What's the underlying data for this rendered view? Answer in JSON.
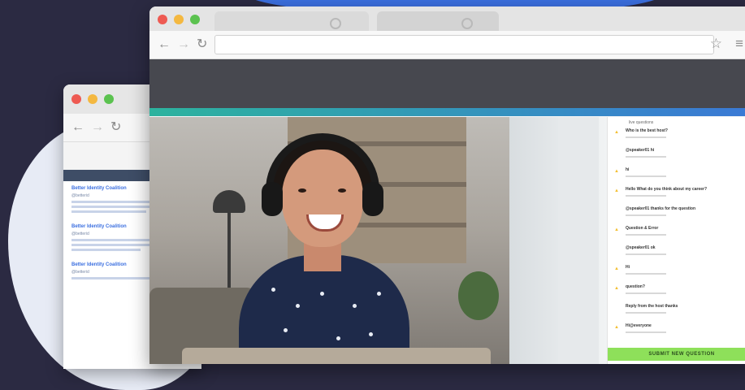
{
  "colors": {
    "background": "#2b2a42",
    "dot_red": "#ee5a52",
    "dot_yellow": "#f4b840",
    "dot_green": "#5bc24f",
    "accent_teal": "#2cb39e",
    "accent_blue": "#3b79d6",
    "submit_green": "#8ee05a",
    "question_icon_yellow": "#f3c033"
  },
  "icons": {
    "back": "←",
    "forward": "→",
    "reload": "↻",
    "star": "☆",
    "menu": "≡",
    "question": "▲"
  },
  "back_window": {
    "tweets": [
      {
        "title": "Better Identity Coalition",
        "text": "@betterid"
      },
      {
        "title": "Better Identity Coalition",
        "text": "@betterid"
      },
      {
        "title": "Better Identity Coalition",
        "text": "@betterid"
      }
    ]
  },
  "chat": {
    "header": "live questions",
    "messages": [
      {
        "text": "Who is the best host?",
        "icon": true
      },
      {
        "text": "@speaker01 hi",
        "icon": false
      },
      {
        "text": "hi",
        "icon": true
      },
      {
        "text": "Hello What do you think about my career?",
        "icon": true
      },
      {
        "text": "@speaker01 thanks for the question",
        "icon": false
      },
      {
        "text": "Question & Error",
        "icon": true
      },
      {
        "text": "@speaker01 ok",
        "icon": false
      },
      {
        "text": "Hi",
        "icon": true
      },
      {
        "text": "question?",
        "icon": true
      },
      {
        "text": "Reply from the host thanks",
        "icon": false
      },
      {
        "text": "Hi@everyone",
        "icon": true
      }
    ],
    "submit_label": "SUBMIT NEW QUESTION"
  }
}
